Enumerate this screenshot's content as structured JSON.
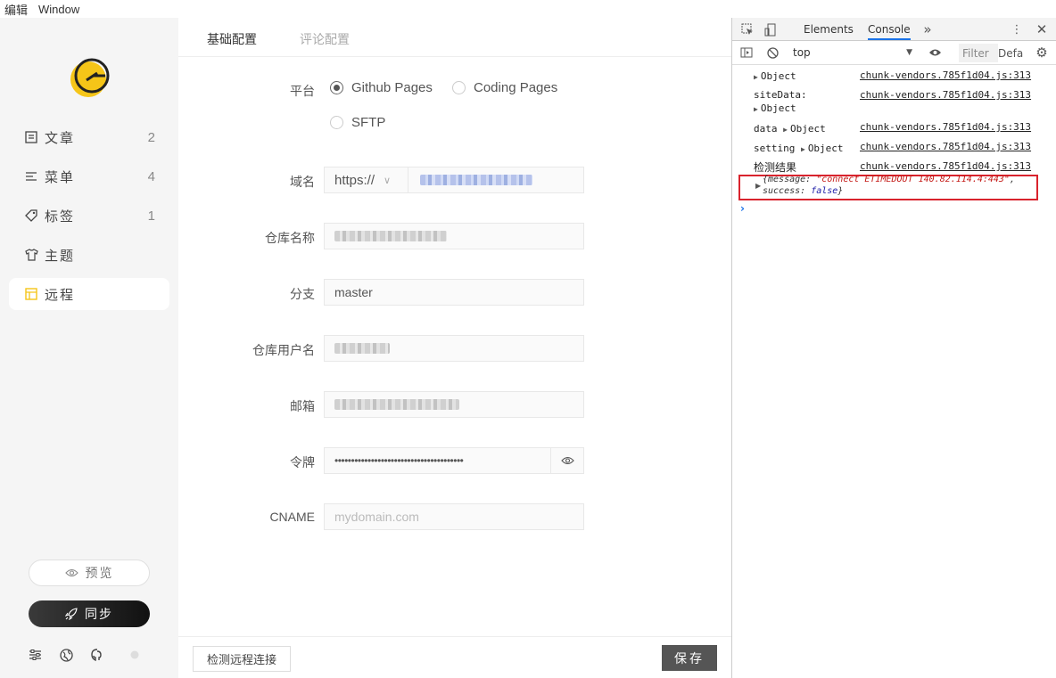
{
  "menubar": {
    "items": [
      "编辑",
      "Window"
    ]
  },
  "sidebar": {
    "items": [
      {
        "label": "文章",
        "count": "2",
        "icon": "article-icon"
      },
      {
        "label": "菜单",
        "count": "4",
        "icon": "menu-icon"
      },
      {
        "label": "标签",
        "count": "1",
        "icon": "tag-icon"
      },
      {
        "label": "主题",
        "count": "",
        "icon": "shirt-icon"
      },
      {
        "label": "远程",
        "count": "",
        "icon": "remote-icon"
      }
    ],
    "active": "远程",
    "preview_label": "预览",
    "sync_label": "同步",
    "accent_color": "#f5c518"
  },
  "tabs": [
    "基础配置",
    "评论配置"
  ],
  "form": {
    "platform_label": "平台",
    "platform_options": [
      "Github Pages",
      "Coding Pages",
      "SFTP"
    ],
    "platform_selected": "Github Pages",
    "domain_label": "域名",
    "domain_protocol": "https://",
    "repo_label": "仓库名称",
    "branch_label": "分支",
    "branch_value": "master",
    "username_label": "仓库用户名",
    "email_label": "邮箱",
    "token_label": "令牌",
    "token_value": "•••••••••••••••••••••••••••••••••••••••",
    "cname_label": "CNAME",
    "cname_placeholder": "mydomain.com"
  },
  "footer": {
    "check_button": "检测远程连接",
    "save_button": "保存"
  },
  "devtools": {
    "tabs": [
      "Elements",
      "Console"
    ],
    "active_tab": "Console",
    "context": "top",
    "filter_placeholder": "Filter",
    "levels": "Defa",
    "logs": [
      {
        "text": "Object",
        "expandable": true,
        "source": "chunk-vendors.785f1d04.js:313"
      },
      {
        "text": "siteData:",
        "sub": "Object",
        "source": "chunk-vendors.785f1d04.js:313"
      },
      {
        "text": "data",
        "sub": "Object",
        "source": "chunk-vendors.785f1d04.js:313"
      },
      {
        "text": "setting",
        "sub": "Object",
        "source": "chunk-vendors.785f1d04.js:313"
      },
      {
        "text": "检测结果",
        "source": "chunk-vendors.785f1d04.js:313"
      }
    ],
    "error": {
      "open": "{message: ",
      "message": "\"connect ETIMEDOUT 140.82.114.4:443\"",
      "mid": ", success: ",
      "success": "false",
      "close": "}"
    }
  }
}
